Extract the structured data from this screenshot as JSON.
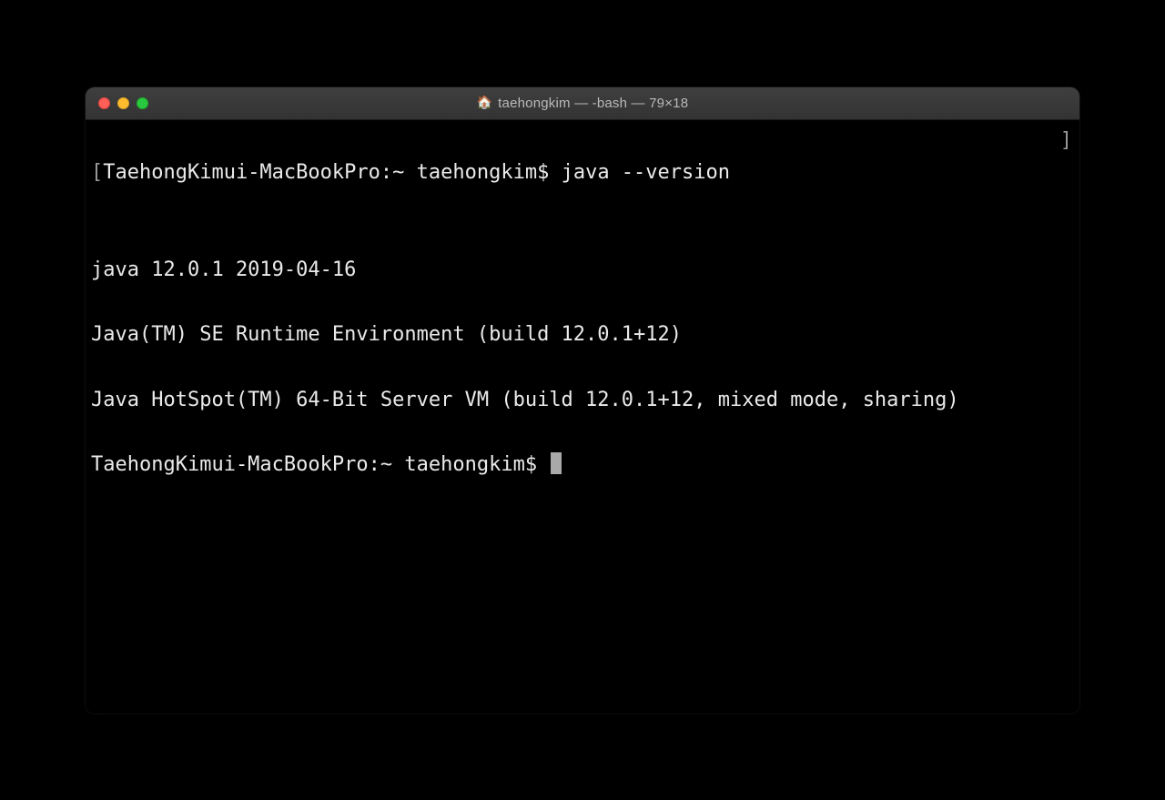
{
  "window": {
    "title": "taehongkim — -bash — 79×18"
  },
  "terminal": {
    "prompt1_prefix_bracket": "[",
    "prompt1": "TaehongKimui-MacBookPro:~ taehongkim$ ",
    "command1": "java --version",
    "right_bracket": "]",
    "output": [
      "java 12.0.1 2019-04-16",
      "Java(TM) SE Runtime Environment (build 12.0.1+12)",
      "Java HotSpot(TM) 64-Bit Server VM (build 12.0.1+12, mixed mode, sharing)"
    ],
    "prompt2": "TaehongKimui-MacBookPro:~ taehongkim$ "
  }
}
